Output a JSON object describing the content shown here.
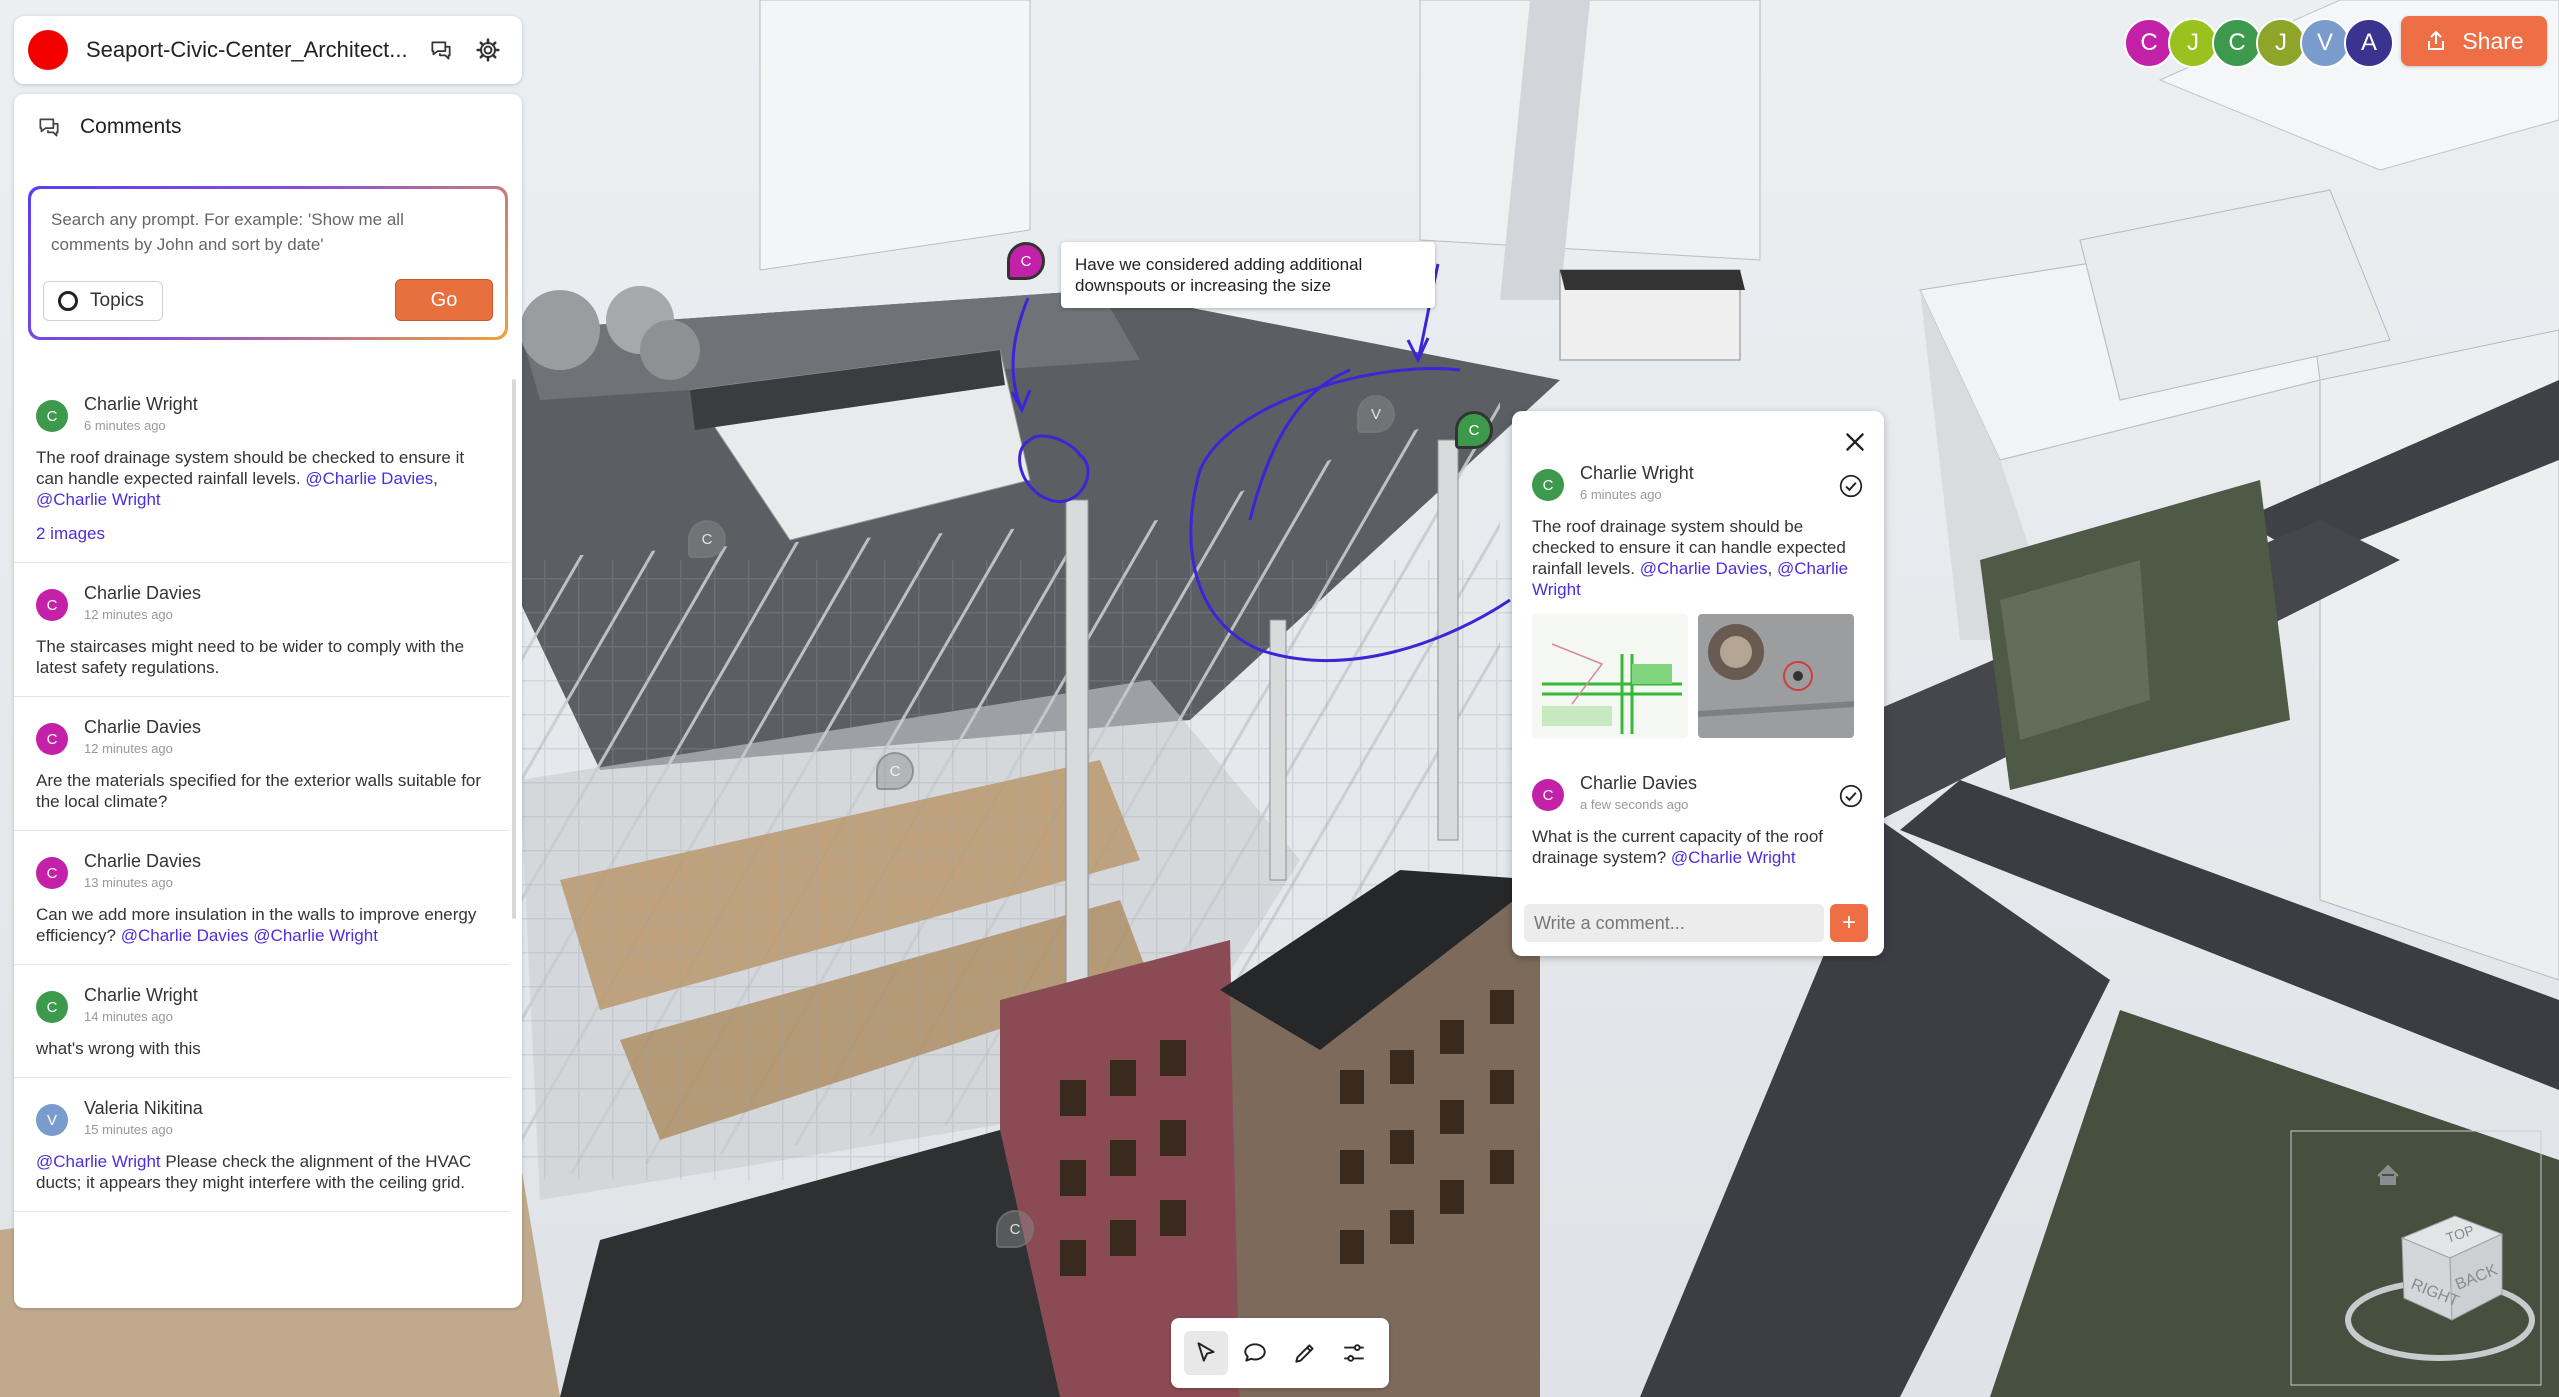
{
  "app": {
    "document_title": "Seaport-Civic-Center_Architect...",
    "brand_color": "#f20000",
    "icons": {
      "comments": "comments-icon",
      "settings": "gear-icon"
    }
  },
  "sidebar": {
    "title": "Comments",
    "prompt": {
      "placeholder": "Search any prompt. For example: 'Show me all comments by John and sort by date'",
      "topics_label": "Topics",
      "go_label": "Go"
    },
    "comments": [
      {
        "author": "Charlie Wright",
        "initial": "C",
        "color": "#3d9a4c",
        "time": "6 minutes ago",
        "text": "The roof drainage system should be checked to ensure it can handle expected rainfall levels. ",
        "mentions": [
          "@Charlie Davies",
          "@Charlie Wright"
        ],
        "link": "2 images"
      },
      {
        "author": "Charlie Davies",
        "initial": "C",
        "color": "#c321a8",
        "time": "12 minutes ago",
        "text": "The staircases might need to be wider to comply with the latest safety regulations."
      },
      {
        "author": "Charlie Davies",
        "initial": "C",
        "color": "#c321a8",
        "time": "12 minutes ago",
        "text": "Are the materials specified for the exterior walls suitable for the local climate?"
      },
      {
        "author": "Charlie Davies",
        "initial": "C",
        "color": "#c321a8",
        "time": "13 minutes ago",
        "text": "Can we add more insulation in the walls to improve energy efficiency? ",
        "mentions": [
          "@Charlie Davies",
          "@Charlie Wright"
        ]
      },
      {
        "author": "Charlie Wright",
        "initial": "C",
        "color": "#3d9a4c",
        "time": "14 minutes ago",
        "text": "what's wrong with this"
      },
      {
        "author": "Valeria Nikitina",
        "initial": "V",
        "color": "#7a9ccc",
        "time": "15 minutes ago",
        "mention_first": "@Charlie Wright",
        "text": " Please check the alignment of the HVAC ducts; it appears they might interfere with the ceiling grid."
      }
    ]
  },
  "collaborators": [
    {
      "initial": "C",
      "color": "#c321a8"
    },
    {
      "initial": "J",
      "color": "#9ac21e"
    },
    {
      "initial": "C",
      "color": "#3d9a4c"
    },
    {
      "initial": "J",
      "color": "#8ea52a"
    },
    {
      "initial": "V",
      "color": "#7a9ccc"
    },
    {
      "initial": "A",
      "color": "#3a3390"
    }
  ],
  "share_label": "Share",
  "callout": {
    "text": "Have we considered adding additional downspouts or increasing the size",
    "pin_initial": "C",
    "pin_color": "#c321a8"
  },
  "scene_pins": [
    {
      "initial": "C",
      "color": "#3d9a4c",
      "type": "active"
    },
    {
      "initial": "V",
      "type": "ghost"
    },
    {
      "initial": "C",
      "type": "ghost"
    },
    {
      "initial": "C",
      "type": "ghost"
    },
    {
      "initial": "C",
      "type": "ghost"
    }
  ],
  "thread": {
    "items": [
      {
        "author": "Charlie Wright",
        "initial": "C",
        "color": "#3d9a4c",
        "time": "6 minutes ago",
        "text": "The roof drainage system should be checked to ensure it can handle expected rainfall levels. ",
        "mentions": [
          "@Charlie Davies",
          "@Charlie Wright"
        ]
      },
      {
        "author": "Charlie Davies",
        "initial": "C",
        "color": "#c321a8",
        "time": "a few seconds ago",
        "text": "What is the current capacity of the roof drainage system? ",
        "mentions": [
          "@Charlie Wright"
        ]
      }
    ],
    "input_placeholder": "Write a comment...",
    "send_label": "+"
  },
  "toolbar": {
    "tools": [
      "select-tool",
      "comment-tool",
      "pen-tool",
      "settings-sliders-tool"
    ],
    "active": "select-tool"
  },
  "navcube": {
    "faces": [
      "RIGHT",
      "BACK",
      "TOP"
    ]
  }
}
